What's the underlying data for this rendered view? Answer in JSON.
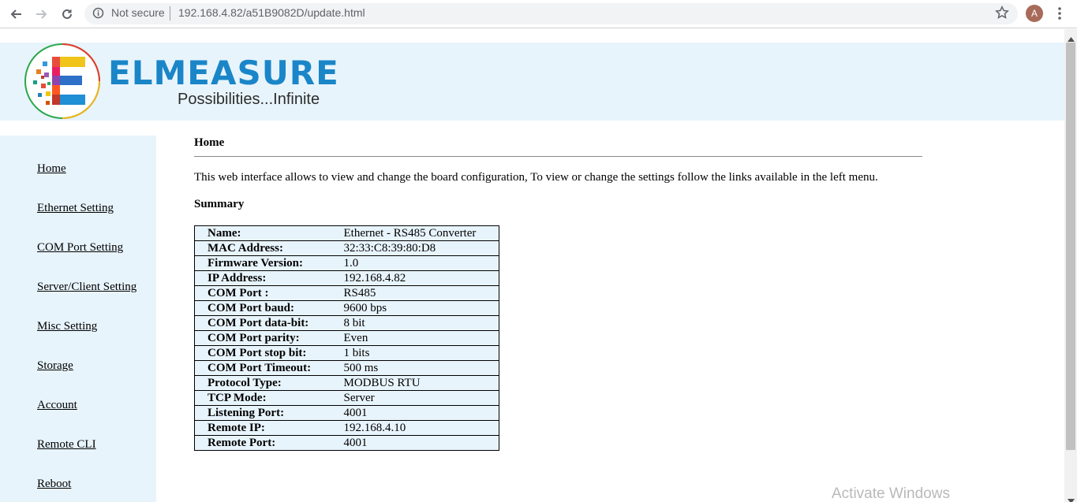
{
  "browser": {
    "security_label": "Not secure",
    "url": "192.168.4.82/a51B9082D/update.html",
    "profile_initial": "A"
  },
  "header": {
    "brand": "ELMEASURE",
    "tagline": "Possibilities...Infinite"
  },
  "sidebar": {
    "items": [
      {
        "label": "Home"
      },
      {
        "label": "Ethernet Setting"
      },
      {
        "label": "COM Port Setting"
      },
      {
        "label": "Server/Client Setting"
      },
      {
        "label": "Misc Setting"
      },
      {
        "label": "Storage"
      },
      {
        "label": "Account"
      },
      {
        "label": "Remote CLI"
      },
      {
        "label": "Reboot"
      }
    ]
  },
  "main": {
    "title": "Home",
    "intro": "This web interface allows to view and change the board configuration, To view or change the settings follow the links available in the left menu.",
    "summary_title": "Summary",
    "summary_rows": [
      {
        "key": "Name:",
        "value": "Ethernet - RS485 Converter"
      },
      {
        "key": "MAC Address:",
        "value": "32:33:C8:39:80:D8"
      },
      {
        "key": "Firmware Version:",
        "value": "1.0"
      },
      {
        "key": "IP Address:",
        "value": "192.168.4.82"
      },
      {
        "key": "COM Port :",
        "value": "RS485"
      },
      {
        "key": "COM Port baud:",
        "value": "9600 bps"
      },
      {
        "key": "COM Port data-bit:",
        "value": "8 bit"
      },
      {
        "key": "COM Port parity:",
        "value": "Even"
      },
      {
        "key": "COM Port stop bit:",
        "value": "1 bits"
      },
      {
        "key": "COM Port Timeout:",
        "value": "500 ms"
      },
      {
        "key": "Protocol Type:",
        "value": "MODBUS RTU"
      },
      {
        "key": "TCP Mode:",
        "value": "Server"
      },
      {
        "key": "Listening Port:",
        "value": "4001"
      },
      {
        "key": "Remote IP:",
        "value": "192.168.4.10"
      },
      {
        "key": "Remote Port:",
        "value": "4001"
      }
    ]
  },
  "overlay": {
    "watermark": "Activate Windows"
  },
  "colors": {
    "brand_blue": "#1a86c8",
    "panel_bg": "#e8f4fc"
  }
}
